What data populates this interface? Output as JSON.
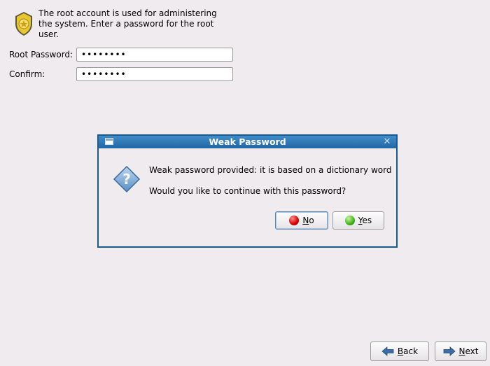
{
  "intro": {
    "text": "The root account is used for administering the system.  Enter a password for the root user."
  },
  "fields": {
    "root_label": "Root Password:",
    "root_value": "••••••••",
    "confirm_label": "Confirm:",
    "confirm_value": "••••••••"
  },
  "dialog": {
    "title": "Weak Password",
    "message": "Weak password provided: it is based on a dictionary word",
    "question": "Would you like to continue with this password?",
    "no_label": "No",
    "yes_label": "Yes"
  },
  "nav": {
    "back_label": "Back",
    "next_label": "Next"
  },
  "colors": {
    "titlebar": "#2466a4",
    "dialog_border": "#1a5a8c",
    "background": "#efebef"
  }
}
